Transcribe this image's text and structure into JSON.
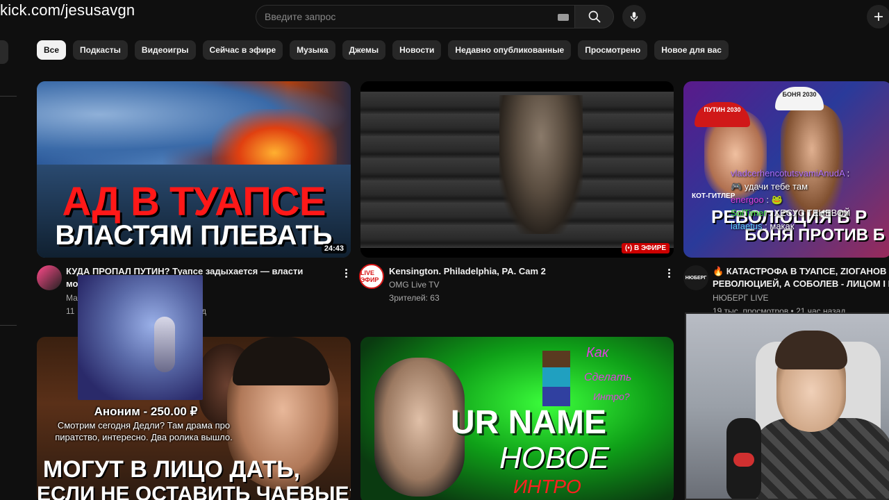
{
  "overlay": {
    "url": "kick.com/jesusavgn"
  },
  "search": {
    "placeholder": "Введите запрос"
  },
  "icons": {
    "keyboard": "keyboard-icon",
    "search": "search-icon",
    "mic": "mic-icon",
    "create": "plus-icon"
  },
  "chips": [
    {
      "label": "Все",
      "active": true
    },
    {
      "label": "Подкасты"
    },
    {
      "label": "Видеоигры"
    },
    {
      "label": "Сейчас в эфире"
    },
    {
      "label": "Музыка"
    },
    {
      "label": "Джемы"
    },
    {
      "label": "Новости"
    },
    {
      "label": "Недавно опубликованные"
    },
    {
      "label": "Просмотрено"
    },
    {
      "label": "Новое для вас"
    }
  ],
  "videos": [
    {
      "thumb_line1": "АД В ТУАПСЕ",
      "thumb_line2": "ВЛАСТЯМ ПЛЕВАТЬ",
      "duration": "24:43",
      "title_line1": "КУДА ПРОПАЛ ПУТИН? Туапсе задыхается — власти",
      "title_line2": "мо",
      "channel": "Ма",
      "stats": "11",
      "stats_tail": "д"
    },
    {
      "live_badge": "(•) В ЭФИРЕ",
      "avatar_text": "LIVE ЭФИР",
      "title_line1": "Kensington. Philadelphia, PA. Cam 2",
      "channel": "OMG Live TV",
      "stats": "Зрителей: 63"
    },
    {
      "thumb_cap1": "ПУТИН 2030",
      "thumb_cap2": "БОНЯ 2030",
      "thumb_kot": "КОТ-ГИТЛЕР",
      "thumb_title1": "РЕВОЛЮЦИЯ В Р",
      "thumb_title2": "БОНЯ ПРОТИВ Б",
      "avatar_text": "НЮБЕРГ",
      "title_line1": "🔥 КАТАСТРОФА В ТУАПСЕ, ZIОГАНОВ П",
      "title_line2": "РЕВОЛЮЦИЕЙ, А СОБОЛЕВ - ЛИЦОМ І М",
      "channel": "НЮБЕРГ LIVE",
      "stats": "19 тыс. просмотров • 21 час назад"
    },
    {
      "thumb_line1": "МОГУТ В ЛИЦО ДАТЬ,",
      "thumb_line2": "ЕСЛИ НЕ ОСТАВИТЬ ЧАЕВЫЕ?"
    },
    {
      "thumb_kak": "Как",
      "thumb_sdelat": "Сделать",
      "thumb_intro": "Интро?",
      "thumb_name": "UR NAME",
      "thumb_novoe": "НОВОЕ",
      "thumb_intro2": "ИНТРО"
    }
  ],
  "donation": {
    "name": "Аноним - 250.00 ₽",
    "message": "Смотрим сегодня Дедли? Там драма про пиратство, интересно. Два ролика вышло."
  },
  "chat": [
    {
      "user": "vladcerhencotutsvamiAnudA",
      "sep": " :",
      "msg": "",
      "color": "#b070ff"
    },
    {
      "user": "🎮",
      "sep": " ",
      "msg": "удачи тебе там",
      "color": "#b070ff"
    },
    {
      "user": "energoo",
      "sep": " : ",
      "msg": "🐸",
      "color": "#e040e0"
    },
    {
      "user": "SolTimer",
      "sep": " : ",
      "msg": "ХЕСУС ТЕНЕВОЙ",
      "color": "#40e040"
    },
    {
      "user": "lafaetus",
      "sep": " : ",
      "msg": "макак",
      "color": "#60d0ff"
    }
  ]
}
